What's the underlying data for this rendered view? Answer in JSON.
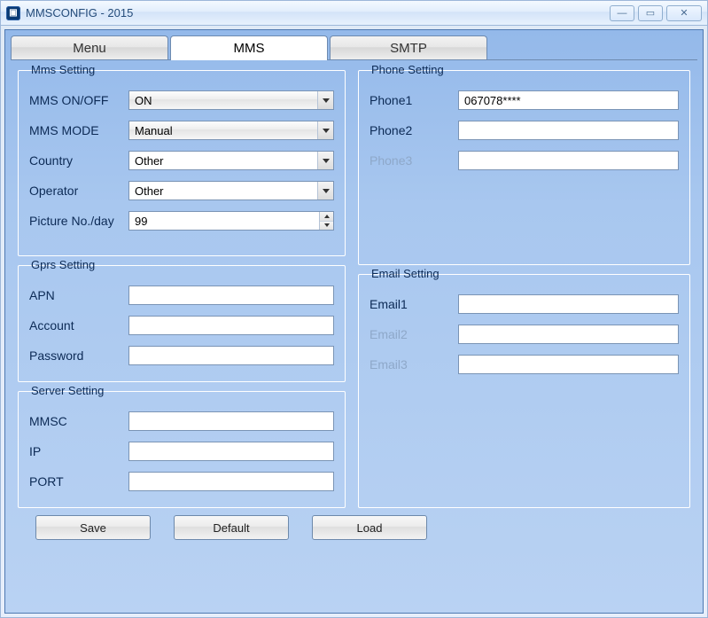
{
  "window": {
    "title": "MMSCONFIG - 2015"
  },
  "tabs": {
    "menu": "Menu",
    "mms": "MMS",
    "smtp": "SMTP",
    "active": "mms"
  },
  "mms_setting": {
    "legend": "Mms Setting",
    "mms_onoff_label": "MMS ON/OFF",
    "mms_onoff_value": "ON",
    "mms_mode_label": "MMS MODE",
    "mms_mode_value": "Manual",
    "country_label": "Country",
    "country_value": "Other",
    "operator_label": "Operator",
    "operator_value": "Other",
    "picture_no_label": "Picture No./day",
    "picture_no_value": "99"
  },
  "gprs_setting": {
    "legend": "Gprs Setting",
    "apn_label": "APN",
    "apn_value": "",
    "account_label": "Account",
    "account_value": "",
    "password_label": "Password",
    "password_value": ""
  },
  "server_setting": {
    "legend": "Server Setting",
    "mmsc_label": "MMSC",
    "mmsc_value": "",
    "ip_label": "IP",
    "ip_value": "",
    "port_label": "PORT",
    "port_value": ""
  },
  "phone_setting": {
    "legend": "Phone Setting",
    "phone1_label": "Phone1",
    "phone1_value": "067078****",
    "phone2_label": "Phone2",
    "phone2_value": "",
    "phone3_label": "Phone3",
    "phone3_value": "",
    "phone3_disabled": true
  },
  "email_setting": {
    "legend": "Email Setting",
    "email1_label": "Email1",
    "email1_value": "",
    "email2_label": "Email2",
    "email2_value": "",
    "email2_disabled": true,
    "email3_label": "Email3",
    "email3_value": "",
    "email3_disabled": true
  },
  "buttons": {
    "save": "Save",
    "default": "Default",
    "load": "Load"
  }
}
